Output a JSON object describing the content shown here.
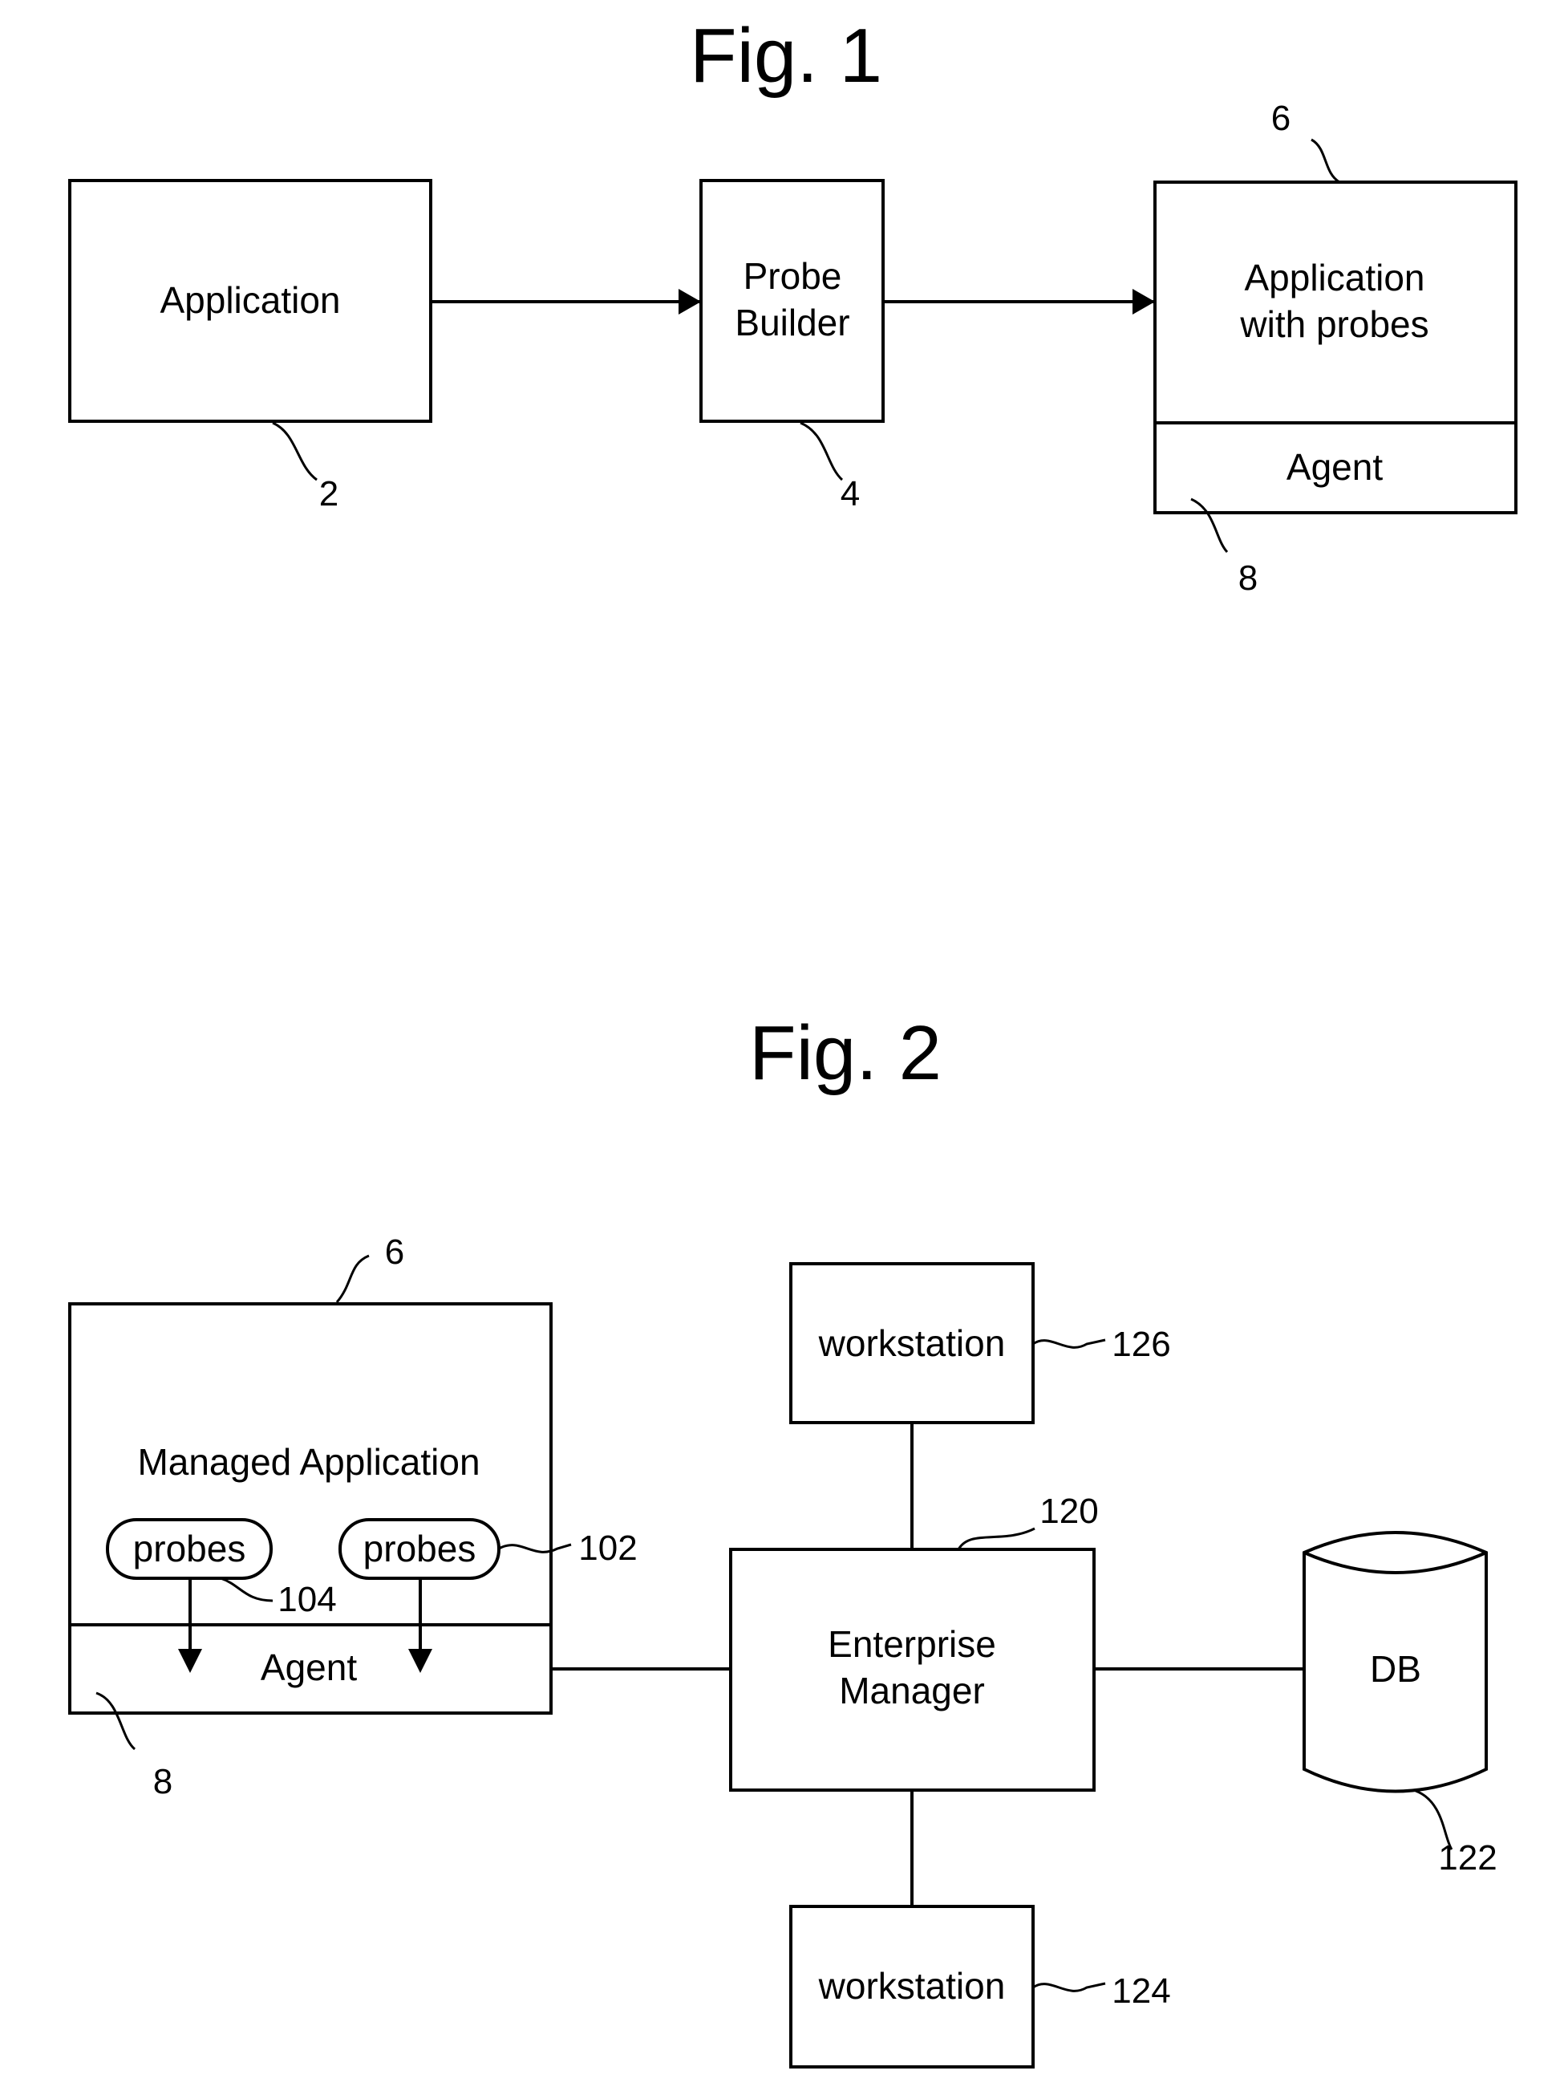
{
  "fig1": {
    "title": "Fig. 1",
    "application": {
      "label": "Application",
      "ref": "2"
    },
    "probe_builder": {
      "line1": "Probe",
      "line2": "Builder",
      "ref": "4"
    },
    "app_with_probes": {
      "line1": "Application",
      "line2": "with probes",
      "ref": "6"
    },
    "agent": {
      "label": "Agent",
      "ref": "8"
    }
  },
  "fig2": {
    "title": "Fig. 2",
    "managed_app": {
      "label": "Managed Application",
      "ref": "6"
    },
    "probes_left": {
      "label": "probes",
      "ref": "104"
    },
    "probes_right": {
      "label": "probes",
      "ref": "102"
    },
    "agent": {
      "label": "Agent",
      "ref": "8"
    },
    "enterprise_manager": {
      "line1": "Enterprise",
      "line2": "Manager",
      "ref": "120"
    },
    "db": {
      "label": "DB",
      "ref": "122"
    },
    "workstation_top": {
      "label": "workstation",
      "ref": "126"
    },
    "workstation_bottom": {
      "label": "workstation",
      "ref": "124"
    }
  }
}
